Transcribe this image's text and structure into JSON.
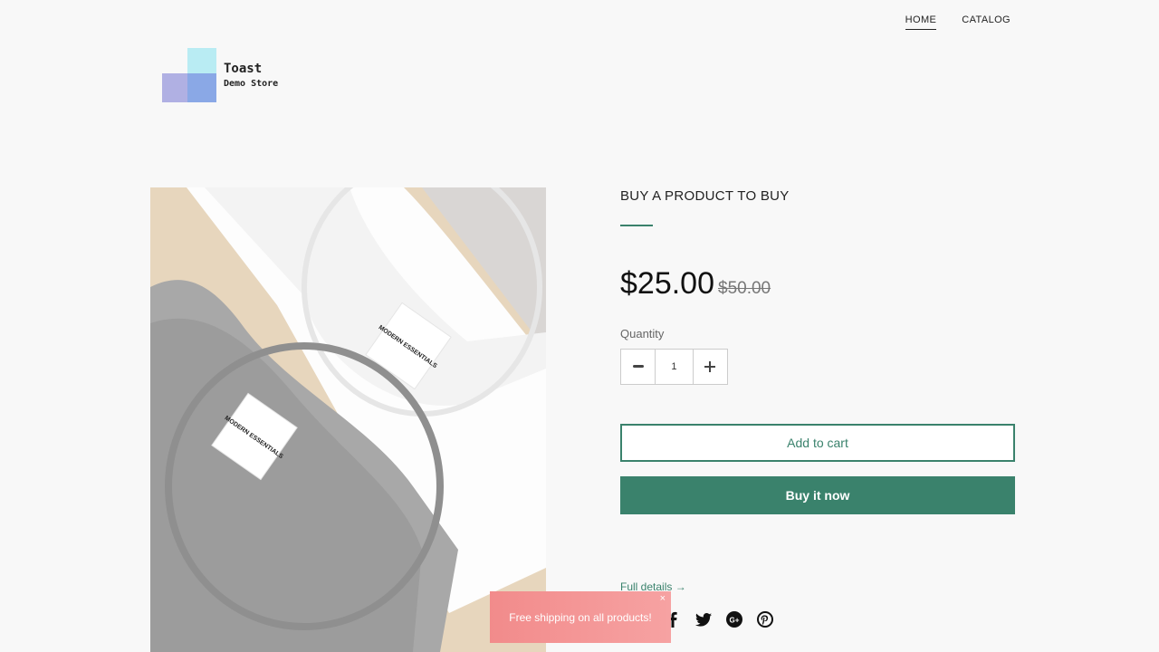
{
  "nav": {
    "items": [
      {
        "label": "HOME"
      },
      {
        "label": "CATALOG"
      }
    ]
  },
  "logo": {
    "title": "Toast",
    "subtitle": "Demo Store"
  },
  "product": {
    "image_label": "MODERN ESSENTIALS",
    "title": "BUY A PRODUCT TO BUY",
    "price": "$25.00",
    "compare_price": "$50.00",
    "quantity_label": "Quantity",
    "quantity_value": "1",
    "add_to_cart": "Add to cart",
    "buy_now": "Buy it now",
    "full_details": "Full details →"
  },
  "social": {
    "icons": [
      "facebook-icon",
      "twitter-icon",
      "google-plus-icon",
      "pinterest-icon"
    ]
  },
  "toast": {
    "message": "Free shipping on all products!",
    "close": "×"
  },
  "colors": {
    "accent": "#3a826c",
    "toast": "#f28b8b",
    "background": "#f8f8f8"
  }
}
